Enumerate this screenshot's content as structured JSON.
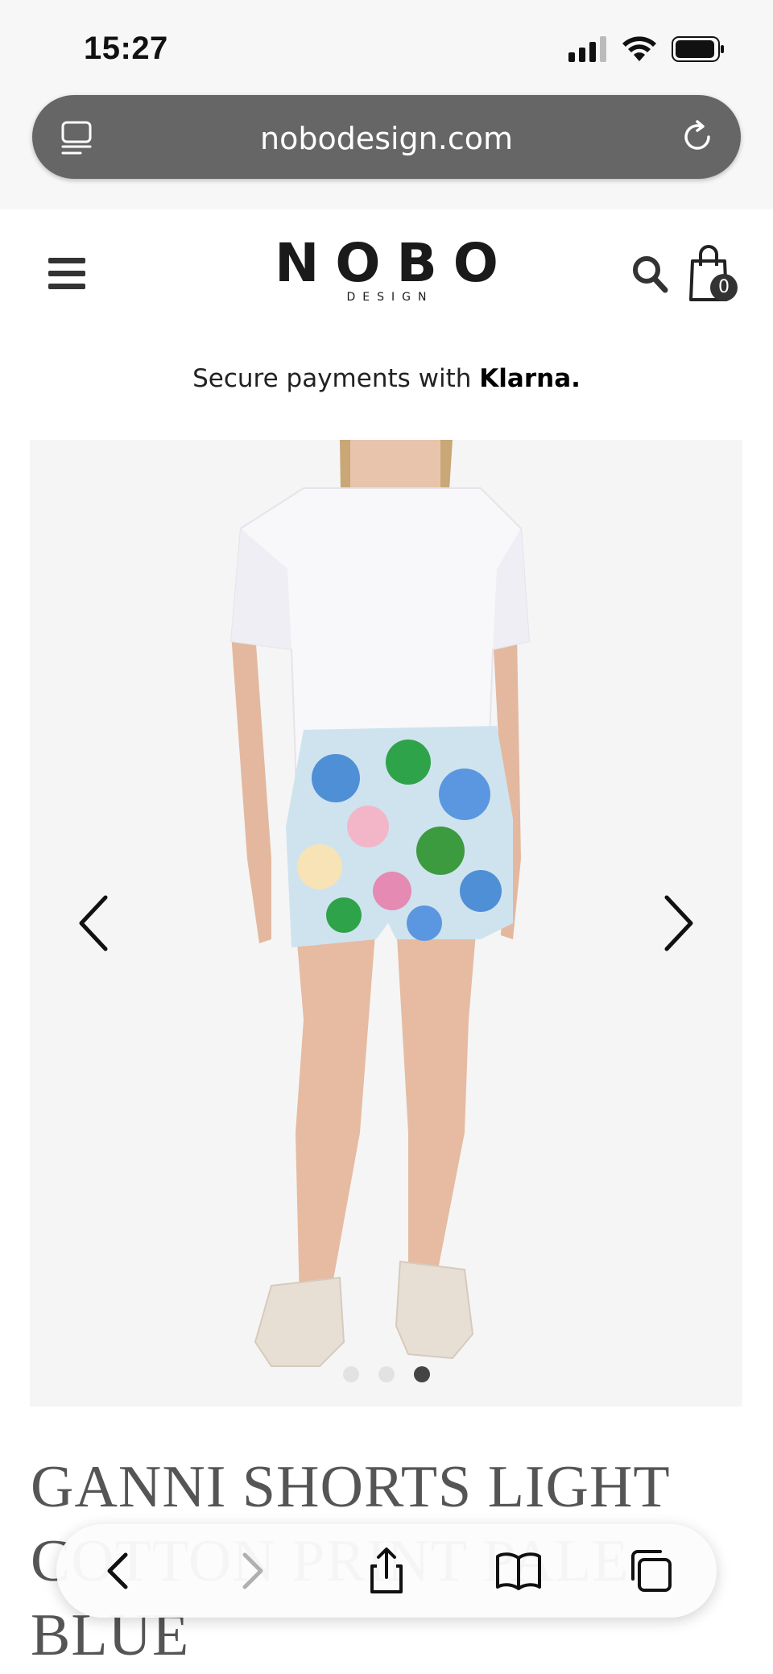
{
  "status_bar": {
    "time": "15:27"
  },
  "browser": {
    "url": "nobodesign.com"
  },
  "header": {
    "logo_main": "NOBO",
    "logo_sub": "DESIGN",
    "cart_count": "0"
  },
  "promo": {
    "prefix": "Secure payments with ",
    "brand": "Klarna."
  },
  "gallery": {
    "total_slides": 3,
    "active_slide": 3
  },
  "product": {
    "title": "GANNI SHORTS LIGHT COTTON PRINT PALE BLUE"
  },
  "icons": [
    "reader-icon",
    "reload-icon",
    "menu-icon",
    "search-icon",
    "shopping-bag-icon",
    "chevron-left-icon",
    "chevron-right-icon",
    "back-icon",
    "forward-icon",
    "share-icon",
    "bookmarks-icon",
    "tabs-icon"
  ]
}
